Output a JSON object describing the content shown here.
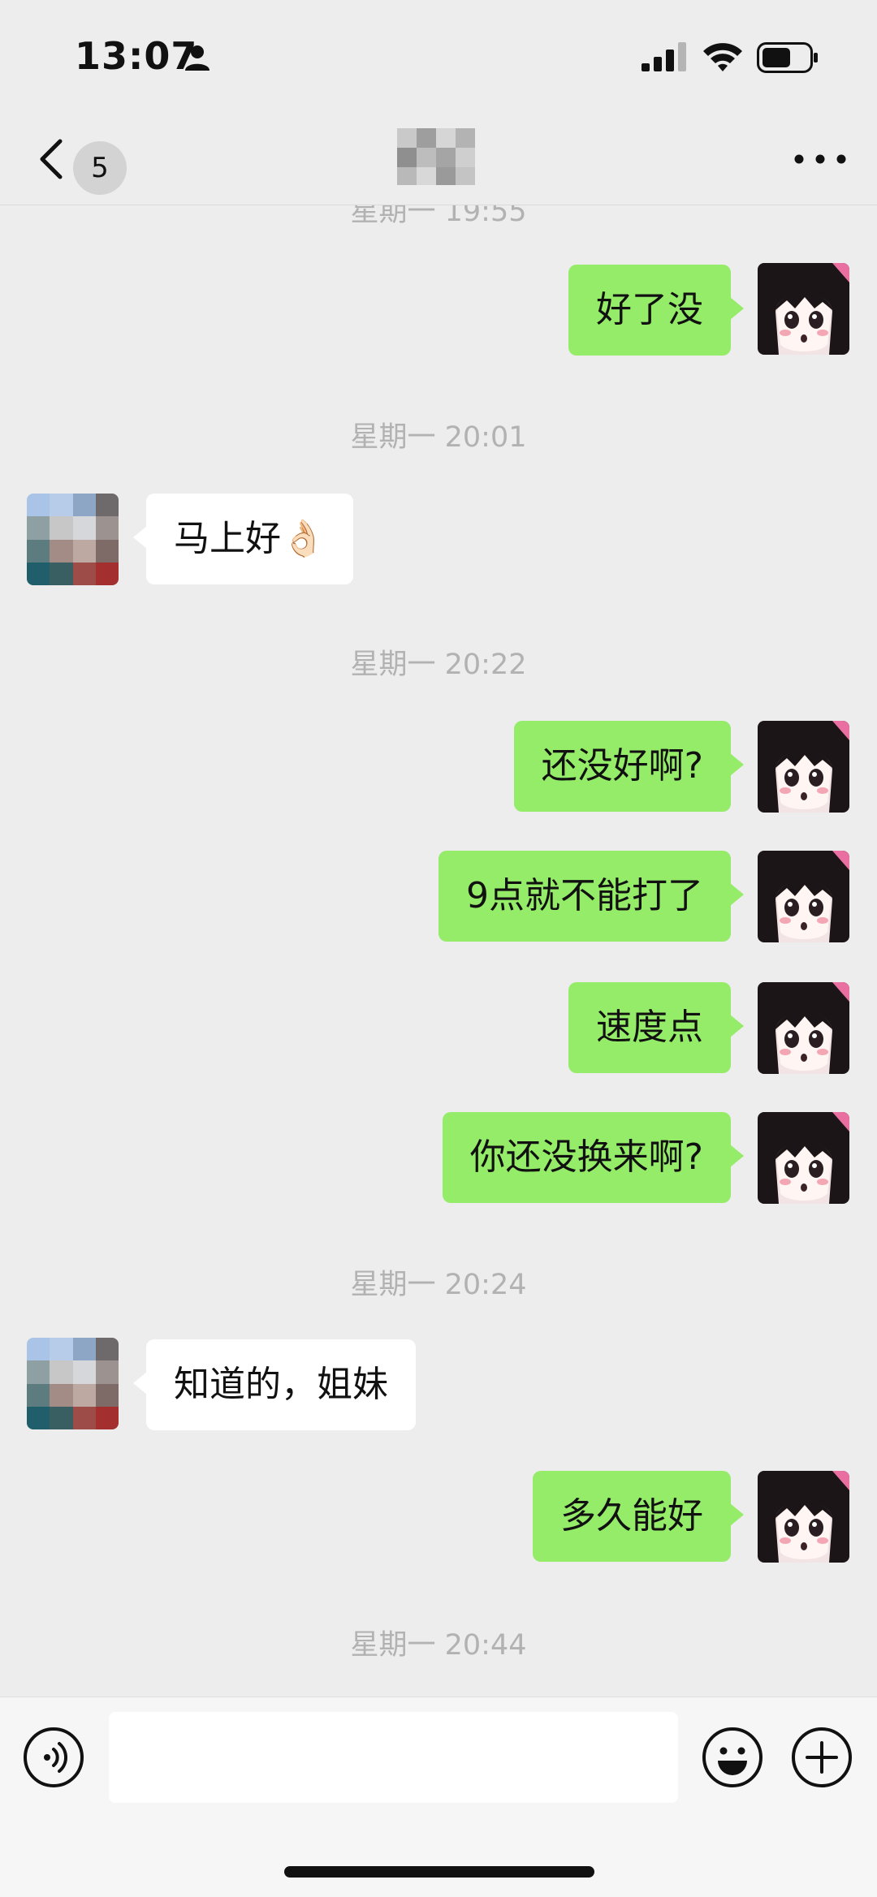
{
  "status_bar": {
    "time": "13:07",
    "icons": [
      "person-icon",
      "signal-icon",
      "wifi-icon",
      "battery-icon"
    ]
  },
  "nav": {
    "back_icon": "chevron-left-icon",
    "unread_count": "5",
    "more_icon": "more-dots-icon"
  },
  "chat": {
    "top_partial_timestamp": "星期一 19:55",
    "timestamps": [
      "星期一 20:01",
      "星期一 20:22",
      "星期一 20:24",
      "星期一 20:44"
    ],
    "messages": [
      {
        "from": "me",
        "text": "好了没"
      },
      {
        "from": "them",
        "text": "马上好",
        "emoji": "ok-hand-emoji"
      },
      {
        "from": "me",
        "text": "还没好啊?"
      },
      {
        "from": "me",
        "text": "9点就不能打了"
      },
      {
        "from": "me",
        "text": "速度点"
      },
      {
        "from": "me",
        "text": "你还没换来啊?"
      },
      {
        "from": "them",
        "text": "知道的，姐妹"
      },
      {
        "from": "me",
        "text": "多久能好"
      }
    ],
    "ok_emoji": "👌🏻"
  },
  "input_bar": {
    "voice_icon": "voice-icon",
    "input_value": "",
    "emoji_icon": "emoji-icon",
    "plus_icon": "plus-icon"
  },
  "colors": {
    "background": "#EDEDED",
    "my_bubble": "#95EC69",
    "their_bubble": "#FFFFFF",
    "timestamp": "#B2B2B2"
  }
}
